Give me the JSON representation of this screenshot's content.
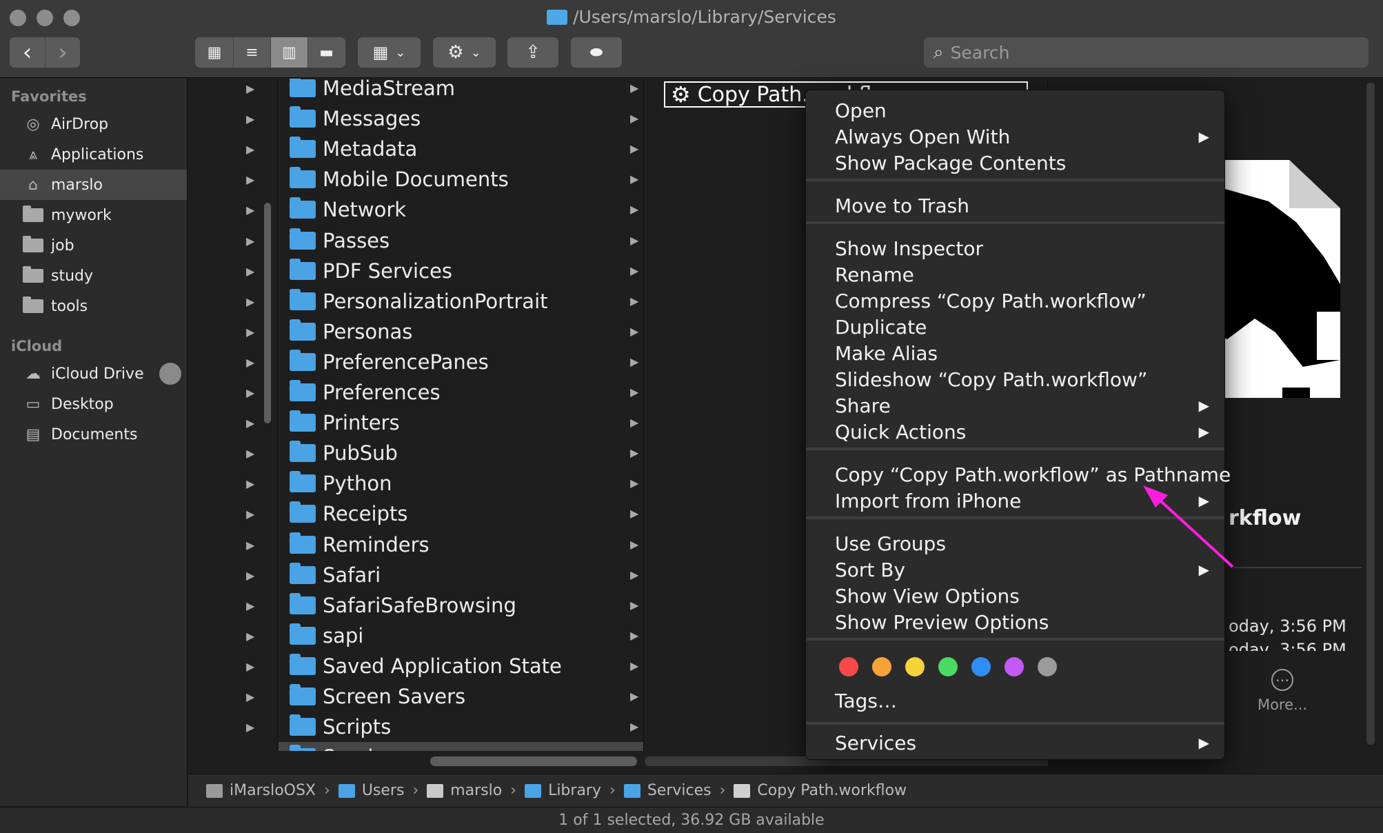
{
  "window": {
    "path_title": "/Users/marslo/Library/Services"
  },
  "toolbar": {
    "back_glyph": "‹",
    "forward_glyph": "›",
    "view_icon": "▦",
    "list_icon": "≡",
    "column_icon": "▥",
    "gallery_icon": "▬",
    "group_icon": "▦",
    "dropdown_glyph": "⌄",
    "action_icon": "⚙",
    "share_icon": "⇪",
    "tag_icon": "⬬"
  },
  "search": {
    "placeholder": "Search",
    "icon": "⌕"
  },
  "sidebar": {
    "favorites_label": "Favorites",
    "favorites": [
      {
        "label": "AirDrop",
        "icon": "airdrop-icon",
        "glyph": "◎"
      },
      {
        "label": "Applications",
        "icon": "applications-icon",
        "glyph": "⩓"
      },
      {
        "label": "marslo",
        "icon": "home-icon",
        "glyph": "⌂"
      },
      {
        "label": "mywork",
        "icon": "folder-icon"
      },
      {
        "label": "job",
        "icon": "folder-icon"
      },
      {
        "label": "study",
        "icon": "folder-icon"
      },
      {
        "label": "tools",
        "icon": "folder-icon"
      }
    ],
    "icloud_label": "iCloud",
    "icloud": [
      {
        "label": "iCloud Drive",
        "icon": "cloud-icon",
        "glyph": "☁"
      },
      {
        "label": "Desktop",
        "icon": "desktop-icon",
        "glyph": "▭"
      },
      {
        "label": "Documents",
        "icon": "document-icon",
        "glyph": "▤"
      }
    ]
  },
  "library_column": [
    "MediaStream",
    "Messages",
    "Metadata",
    "Mobile Documents",
    "Network",
    "Passes",
    "PDF Services",
    "PersonalizationPortrait",
    "Personas",
    "PreferencePanes",
    "Preferences",
    "Printers",
    "PubSub",
    "Python",
    "Receipts",
    "Reminders",
    "Safari",
    "SafariSafeBrowsing",
    "sapi",
    "Saved Application State",
    "Screen Savers",
    "Scripts",
    "Services"
  ],
  "selected_folder": "Services",
  "services_column": {
    "file_name": "Copy Path.workflow",
    "file_icon": "⚙"
  },
  "context_menu": {
    "groups": [
      [
        {
          "label": "Open"
        },
        {
          "label": "Always Open With",
          "submenu": true
        },
        {
          "label": "Show Package Contents"
        }
      ],
      [
        {
          "label": "Move to Trash"
        }
      ],
      [
        {
          "label": "Show Inspector"
        },
        {
          "label": "Rename"
        },
        {
          "label": "Compress “Copy Path.workflow”"
        },
        {
          "label": "Duplicate"
        },
        {
          "label": "Make Alias"
        },
        {
          "label": "Slideshow “Copy Path.workflow”"
        },
        {
          "label": "Share",
          "submenu": true
        },
        {
          "label": "Quick Actions",
          "submenu": true
        }
      ],
      [
        {
          "label": "Copy “Copy Path.workflow” as Pathname"
        },
        {
          "label": "Import from iPhone",
          "submenu": true
        }
      ],
      [
        {
          "label": "Use Groups"
        },
        {
          "label": "Sort By",
          "submenu": true
        },
        {
          "label": "Show View Options"
        },
        {
          "label": "Show Preview Options"
        }
      ]
    ],
    "submenu_glyph": "▶",
    "tag_colors": [
      "#f94a4a",
      "#f7a33a",
      "#f5d33a",
      "#4cd964",
      "#2f8ef5",
      "#c35af5",
      "#9b9b9b"
    ],
    "tags_label": "Tags…",
    "services_label": "Services"
  },
  "preview": {
    "name_fragment": "rkflow",
    "created_fragment": "oday, 3:56 PM",
    "modified_fragment": "oday, 3:56 PM",
    "more_label": "More...",
    "more_glyph": "⋯"
  },
  "pathbar": [
    {
      "label": "iMarsloOSX",
      "icon": "disk-icon",
      "color": "#9a9a9a"
    },
    {
      "label": "Users",
      "icon": "folder-icon",
      "color": "#4aa3e4"
    },
    {
      "label": "marslo",
      "icon": "home-icon",
      "color": "#c9c9c9"
    },
    {
      "label": "Library",
      "icon": "folder-icon",
      "color": "#4aa3e4"
    },
    {
      "label": "Services",
      "icon": "folder-icon",
      "color": "#4aa3e4"
    },
    {
      "label": "Copy Path.workflow",
      "icon": "document-icon",
      "color": "#d0d0d0"
    }
  ],
  "pathbar_separator": "›",
  "status": "1 of 1 selected, 36.92 GB available",
  "annotation": {
    "color": "#ff1ee0"
  }
}
